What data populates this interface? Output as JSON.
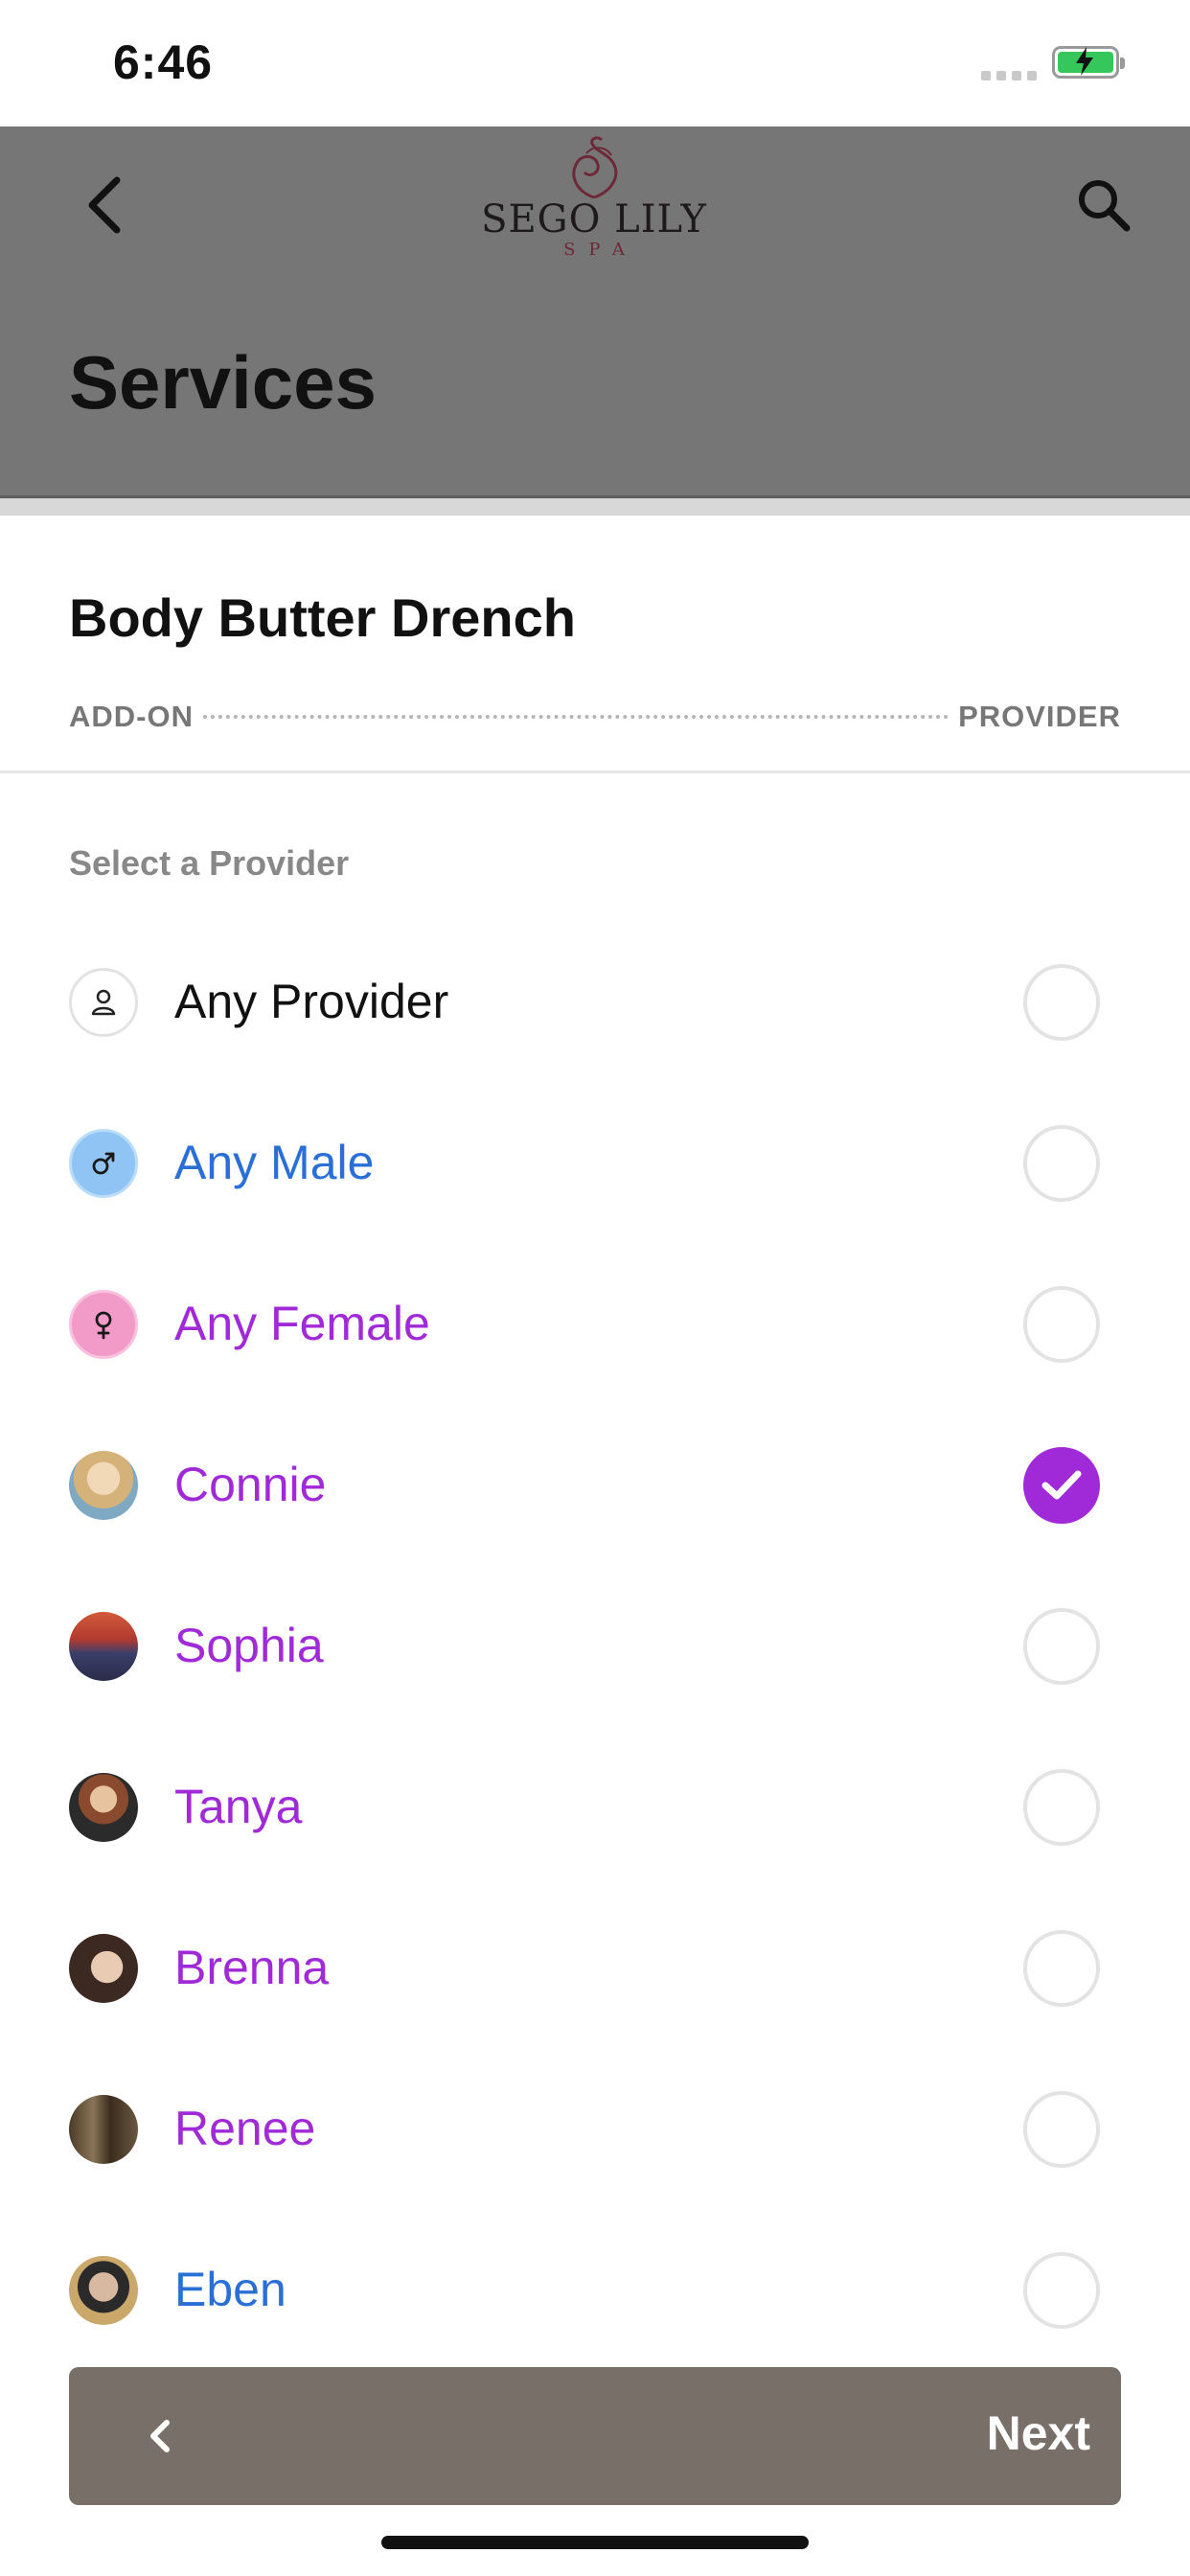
{
  "status_bar": {
    "time": "6:46"
  },
  "header": {
    "logo": {
      "name": "SEGO LILY",
      "sub": "SPA"
    },
    "title": "Services"
  },
  "service": {
    "name": "Body Butter Drench",
    "steps": [
      "ADD-ON",
      "PROVIDER"
    ]
  },
  "provider_section": {
    "label": "Select a Provider",
    "providers": [
      {
        "name": "Any Provider",
        "color": "#111111",
        "selected": false
      },
      {
        "name": "Any Male",
        "color": "#2a6fd6",
        "selected": false
      },
      {
        "name": "Any Female",
        "color": "#a12ad8",
        "selected": false
      },
      {
        "name": "Connie",
        "color": "#a12ad8",
        "selected": true
      },
      {
        "name": "Sophia",
        "color": "#a12ad8",
        "selected": false
      },
      {
        "name": "Tanya",
        "color": "#a12ad8",
        "selected": false
      },
      {
        "name": "Brenna",
        "color": "#a12ad8",
        "selected": false
      },
      {
        "name": "Renee",
        "color": "#a12ad8",
        "selected": false
      },
      {
        "name": "Eben",
        "color": "#2a6fd6",
        "selected": false
      }
    ]
  },
  "footer": {
    "next_label": "Next"
  },
  "colors": {
    "accent_purple": "#a12ad8",
    "male_blue": "#2a6fd6",
    "header_gray": "#767676",
    "footer_brown": "#776f68"
  }
}
